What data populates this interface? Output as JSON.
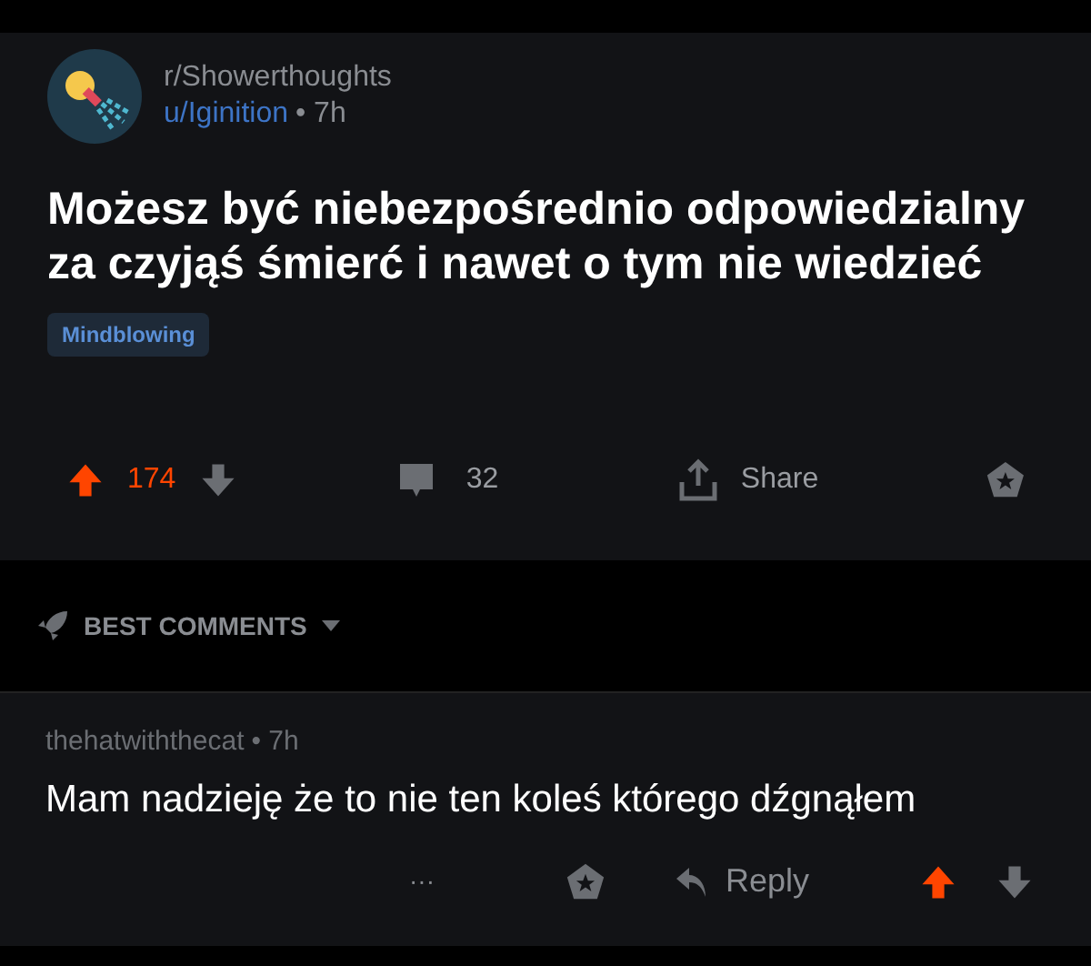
{
  "post": {
    "subreddit": "r/Showerthoughts",
    "author": "u/Iginition",
    "age": "• 7h",
    "title": "Możesz być niebezpośrednio odpowiedzialny za czyjąś śmierć i nawet o tym nie wiedzieć",
    "flair": "Mindblowing",
    "votes": {
      "count": "174",
      "upvoted": true
    },
    "comments": "32",
    "share": "Share"
  },
  "sort": {
    "label": "BEST COMMENTS"
  },
  "comments": [
    {
      "author": "thehatwiththecat",
      "age": "• 7h",
      "text": "Mam nadzieję że to nie ten koleś którego dźgnąłem",
      "more": "···",
      "reply": "Reply",
      "upvoted": true
    }
  ]
}
